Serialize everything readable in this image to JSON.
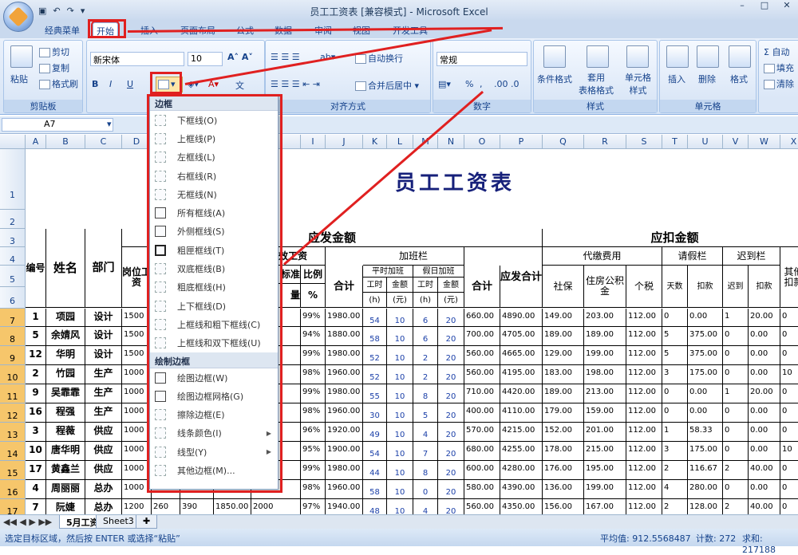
{
  "window": {
    "title": "员工工资表 [兼容模式] - Microsoft Excel"
  },
  "tabs": [
    "经典菜单",
    "开始",
    "插入",
    "页面布局",
    "公式",
    "数据",
    "审阅",
    "视图",
    "开发工具"
  ],
  "ribbon": {
    "clipboard": {
      "paste": "粘贴",
      "cut": "剪切",
      "copy": "复制",
      "format_painter": "格式刷",
      "label": "剪贴板"
    },
    "font": {
      "name": "新宋体",
      "size": "10",
      "bold": "B",
      "italic": "I",
      "underline": "U",
      "wen": "文"
    },
    "alignment": {
      "wrap": "自动换行",
      "merge": "合并后居中",
      "label": "对齐方式"
    },
    "number": {
      "format": "常规",
      "label": "数字",
      "percent": "%",
      "comma": ","
    },
    "styles": {
      "conditional": "条件格式",
      "table": "套用\n表格格式",
      "cell": "单元格\n样式",
      "label": "样式"
    },
    "cells": {
      "insert": "插入",
      "delete": "删除",
      "format": "格式",
      "label": "单元格"
    },
    "editing": {
      "sum": "Σ",
      "sum_label": "自动",
      "fill": "填充",
      "clear": "清除"
    }
  },
  "formula_bar": {
    "name_box": "A7"
  },
  "border_menu": {
    "section1": "边框",
    "items1": [
      "下框线(O)",
      "上框线(P)",
      "左框线(L)",
      "右框线(R)",
      "无框线(N)",
      "所有框线(A)",
      "外侧框线(S)",
      "粗匣框线(T)",
      "双底框线(B)",
      "粗底框线(H)",
      "上下框线(D)",
      "上框线和粗下框线(C)",
      "上框线和双下框线(U)"
    ],
    "section2": "绘制边框",
    "items2": [
      "绘图边框(W)",
      "绘图边框网格(G)",
      "擦除边框(E)",
      "线条颜色(I)",
      "线型(Y)",
      "其他边框(M)..."
    ]
  },
  "columns": [
    "A",
    "B",
    "C",
    "D",
    "E",
    "F",
    "G",
    "H",
    "I",
    "J",
    "K",
    "L",
    "M",
    "N",
    "O",
    "P",
    "Q",
    "R",
    "S",
    "T",
    "U",
    "V",
    "W",
    "X"
  ],
  "sheet": {
    "title": "员工工资表",
    "header": {
      "id": "编号",
      "name": "姓名",
      "dept": "部门",
      "base_pay": "岗位工资",
      "payable": "应发金额",
      "perf": "绩效工资",
      "std": "标准",
      "qty": "量",
      "ratio": "比例",
      "pct": "%",
      "total": "合计",
      "unit_yuan": "（元）",
      "overtime": "加班栏",
      "weekday_ot": "平时加班",
      "holiday_ot": "假日加班",
      "hours": "工时",
      "hours_unit": "(h)",
      "amount": "金额",
      "amount_unit": "(元)",
      "ot_total": "合计",
      "gross": "应发合计",
      "deduct": "应扣金额",
      "withhold": "代缴费用",
      "social": "社保",
      "housing": "住房公积金",
      "tax": "个税",
      "leave": "请假栏",
      "days": "天数",
      "days_unit": "(天)",
      "deduct_amt": "扣款",
      "late": "迟到栏",
      "late_times": "迟到",
      "times_unit": "(次)",
      "other": "其他扣款"
    },
    "row_numbers": [
      "1",
      "2",
      "3",
      "4",
      "5",
      "6",
      "7",
      "8",
      "9",
      "10",
      "11",
      "12",
      "13",
      "14",
      "15",
      "16",
      "17"
    ],
    "rows": [
      {
        "id": "1",
        "name": "项园",
        "dept": "设计",
        "base": "1500",
        "e": "",
        "f": "",
        "g": "",
        "h": "",
        "i": "99%",
        "j": "1980.00",
        "k": "54",
        "l": "10",
        "m": "6",
        "n": "20",
        "o": "660.00",
        "p": "4890.00",
        "q": "149.00",
        "r": "203.00",
        "s": "112.00",
        "t": "0",
        "u": "0.00",
        "v": "1",
        "w": "20.00",
        "x": "0"
      },
      {
        "id": "5",
        "name": "余婧风",
        "dept": "设计",
        "base": "1500",
        "e": "",
        "f": "",
        "g": "",
        "h": "",
        "i": "94%",
        "j": "1880.00",
        "k": "58",
        "l": "10",
        "m": "6",
        "n": "20",
        "o": "700.00",
        "p": "4705.00",
        "q": "189.00",
        "r": "189.00",
        "s": "112.00",
        "t": "5",
        "u": "375.00",
        "v": "0",
        "w": "0.00",
        "x": "0"
      },
      {
        "id": "12",
        "name": "华明",
        "dept": "设计",
        "base": "1500",
        "e": "",
        "f": "",
        "g": "",
        "h": "",
        "i": "99%",
        "j": "1980.00",
        "k": "52",
        "l": "10",
        "m": "2",
        "n": "20",
        "o": "560.00",
        "p": "4665.00",
        "q": "129.00",
        "r": "199.00",
        "s": "112.00",
        "t": "5",
        "u": "375.00",
        "v": "0",
        "w": "0.00",
        "x": "0"
      },
      {
        "id": "2",
        "name": "竹园",
        "dept": "生产",
        "base": "1000",
        "e": "",
        "f": "",
        "g": "",
        "h": "",
        "i": "98%",
        "j": "1960.00",
        "k": "52",
        "l": "10",
        "m": "2",
        "n": "20",
        "o": "560.00",
        "p": "4195.00",
        "q": "183.00",
        "r": "198.00",
        "s": "112.00",
        "t": "3",
        "u": "175.00",
        "v": "0",
        "w": "0.00",
        "x": "10"
      },
      {
        "id": "9",
        "name": "吴霏霏",
        "dept": "生产",
        "base": "1000",
        "e": "",
        "f": "",
        "g": "",
        "h": "",
        "i": "99%",
        "j": "1980.00",
        "k": "55",
        "l": "10",
        "m": "8",
        "n": "20",
        "o": "710.00",
        "p": "4420.00",
        "q": "189.00",
        "r": "213.00",
        "s": "112.00",
        "t": "0",
        "u": "0.00",
        "v": "1",
        "w": "20.00",
        "x": "0"
      },
      {
        "id": "16",
        "name": "程强",
        "dept": "生产",
        "base": "1000",
        "e": "",
        "f": "",
        "g": "",
        "h": "",
        "i": "98%",
        "j": "1960.00",
        "k": "30",
        "l": "10",
        "m": "5",
        "n": "20",
        "o": "400.00",
        "p": "4110.00",
        "q": "179.00",
        "r": "159.00",
        "s": "112.00",
        "t": "0",
        "u": "0.00",
        "v": "0",
        "w": "0.00",
        "x": "0"
      },
      {
        "id": "3",
        "name": "程薇",
        "dept": "供应",
        "base": "1000",
        "e": "",
        "f": "",
        "g": "",
        "h": "",
        "i": "96%",
        "j": "1920.00",
        "k": "49",
        "l": "10",
        "m": "4",
        "n": "20",
        "o": "570.00",
        "p": "4215.00",
        "q": "152.00",
        "r": "201.00",
        "s": "112.00",
        "t": "1",
        "u": "58.33",
        "v": "0",
        "w": "0.00",
        "x": "0"
      },
      {
        "id": "10",
        "name": "唐华明",
        "dept": "供应",
        "base": "1000",
        "e": "",
        "f": "",
        "g": "",
        "h": "",
        "i": "95%",
        "j": "1900.00",
        "k": "54",
        "l": "10",
        "m": "7",
        "n": "20",
        "o": "680.00",
        "p": "4255.00",
        "q": "178.00",
        "r": "215.00",
        "s": "112.00",
        "t": "3",
        "u": "175.00",
        "v": "0",
        "w": "0.00",
        "x": "10"
      },
      {
        "id": "17",
        "name": "黄鑫兰",
        "dept": "供应",
        "base": "1000",
        "e": "",
        "f": "",
        "g": "",
        "h": "",
        "i": "99%",
        "j": "1980.00",
        "k": "44",
        "l": "10",
        "m": "8",
        "n": "20",
        "o": "600.00",
        "p": "4280.00",
        "q": "176.00",
        "r": "195.00",
        "s": "112.00",
        "t": "2",
        "u": "116.67",
        "v": "2",
        "w": "40.00",
        "x": "0"
      },
      {
        "id": "4",
        "name": "周丽丽",
        "dept": "总办",
        "base": "1000",
        "e": "",
        "f": "",
        "g": "",
        "h": "",
        "i": "98%",
        "j": "1960.00",
        "k": "58",
        "l": "10",
        "m": "0",
        "n": "20",
        "o": "580.00",
        "p": "4390.00",
        "q": "136.00",
        "r": "199.00",
        "s": "112.00",
        "t": "4",
        "u": "280.00",
        "v": "0",
        "w": "0.00",
        "x": "0"
      },
      {
        "id": "7",
        "name": "阮婕",
        "dept": "总办",
        "base": "1200",
        "e": "260",
        "f": "390",
        "g": "1850.00",
        "h": "2000",
        "i": "97%",
        "j": "1940.00",
        "k": "48",
        "l": "10",
        "m": "4",
        "n": "20",
        "o": "560.00",
        "p": "4350.00",
        "q": "156.00",
        "r": "167.00",
        "s": "112.00",
        "t": "2",
        "u": "128.00",
        "v": "2",
        "w": "40.00",
        "x": "0"
      }
    ]
  },
  "sheet_tabs": [
    "5月工资",
    "Sheet3"
  ],
  "status": {
    "message": "选定目标区域，然后按 ENTER 或选择“粘贴”",
    "average": "平均值: 912.5568487",
    "count": "计数: 272",
    "sum": "求和: 217188"
  },
  "colors": {
    "accent": "#e02020",
    "title_blue": "#16207a",
    "ribbon": "#d5e3f5"
  }
}
